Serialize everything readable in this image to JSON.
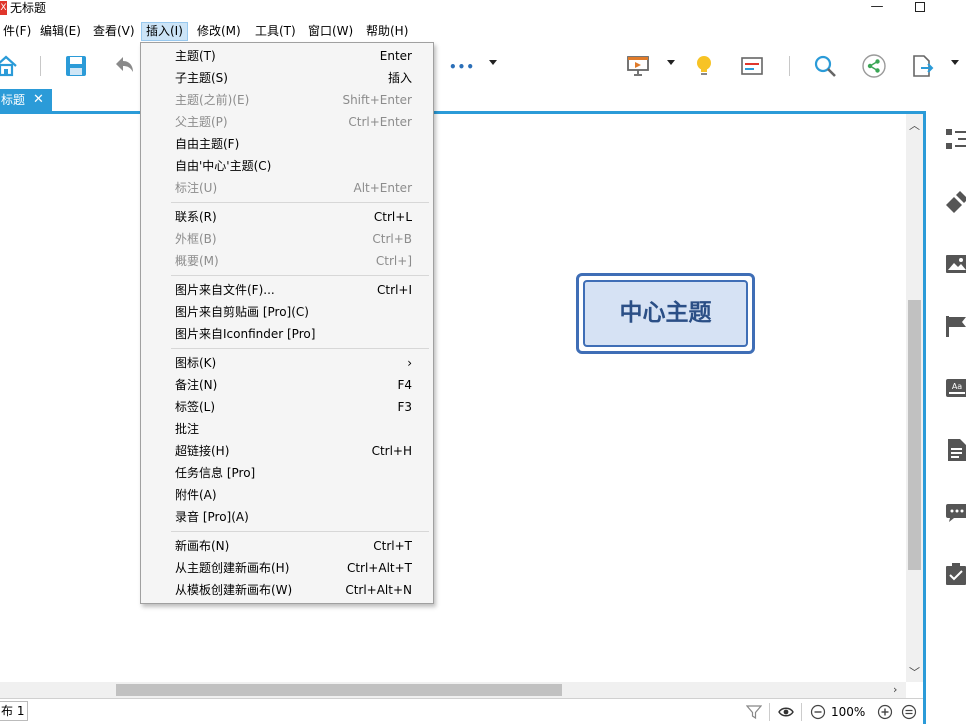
{
  "window": {
    "title": "无标题",
    "logo_text": "X",
    "minimize": "—"
  },
  "menubar": {
    "items": [
      {
        "label": "件(F)"
      },
      {
        "label": "编辑(E)"
      },
      {
        "label": "查看(V)"
      },
      {
        "label": "插入(I)"
      },
      {
        "label": "修改(M)"
      },
      {
        "label": "工具(T)"
      },
      {
        "label": "窗口(W)"
      },
      {
        "label": "帮助(H)"
      }
    ],
    "active_index": 3
  },
  "toolbar": {
    "more_label": "•••"
  },
  "tabs": {
    "doc_tab_label": "标题",
    "doc_tab_close": "✕"
  },
  "insert_menu": {
    "items": [
      {
        "label": "主题(T)",
        "shortcut": "Enter",
        "disabled": false
      },
      {
        "label": "子主题(S)",
        "shortcut": "插入",
        "disabled": false
      },
      {
        "label": "主题(之前)(E)",
        "shortcut": "Shift+Enter",
        "disabled": true
      },
      {
        "label": "父主题(P)",
        "shortcut": "Ctrl+Enter",
        "disabled": true
      },
      {
        "label": "自由主题(F)",
        "shortcut": "",
        "disabled": false
      },
      {
        "label": "自由'中心'主题(C)",
        "shortcut": "",
        "disabled": false
      },
      {
        "label": "标注(U)",
        "shortcut": "Alt+Enter",
        "disabled": true
      },
      {
        "label": "联系(R)",
        "shortcut": "Ctrl+L",
        "disabled": false
      },
      {
        "label": "外框(B)",
        "shortcut": "Ctrl+B",
        "disabled": true
      },
      {
        "label": "概要(M)",
        "shortcut": "Ctrl+]",
        "disabled": true
      },
      {
        "label": "图片来自文件(F)...",
        "shortcut": "Ctrl+I",
        "disabled": false
      },
      {
        "label": "图片来自剪贴画 [Pro](C)",
        "shortcut": "",
        "disabled": false
      },
      {
        "label": "图片来自Iconfinder [Pro]",
        "shortcut": "",
        "disabled": false
      },
      {
        "label": "图标(K)",
        "shortcut": "›",
        "disabled": false
      },
      {
        "label": "备注(N)",
        "shortcut": "F4",
        "disabled": false
      },
      {
        "label": "标签(L)",
        "shortcut": "F3",
        "disabled": false
      },
      {
        "label": "批注",
        "shortcut": "",
        "disabled": false
      },
      {
        "label": "超链接(H)",
        "shortcut": "Ctrl+H",
        "disabled": false
      },
      {
        "label": "任务信息 [Pro]",
        "shortcut": "",
        "disabled": false
      },
      {
        "label": "附件(A)",
        "shortcut": "",
        "disabled": false
      },
      {
        "label": "录音 [Pro](A)",
        "shortcut": "",
        "disabled": false
      },
      {
        "label": "新画布(N)",
        "shortcut": "Ctrl+T",
        "disabled": false
      },
      {
        "label": "从主题创建新画布(H)",
        "shortcut": "Ctrl+Alt+T",
        "disabled": false
      },
      {
        "label": "从模板创建新画布(W)",
        "shortcut": "Ctrl+Alt+N",
        "disabled": false
      }
    ]
  },
  "canvas": {
    "central_topic": "中心主题"
  },
  "statusbar": {
    "sheet_tab": "布 1",
    "zoom": "100%"
  },
  "colors": {
    "accent": "#2b9bd8",
    "topic_border": "#3f6eb6",
    "topic_fill": "#d6e2f4",
    "topic_text": "#2b4f86"
  }
}
